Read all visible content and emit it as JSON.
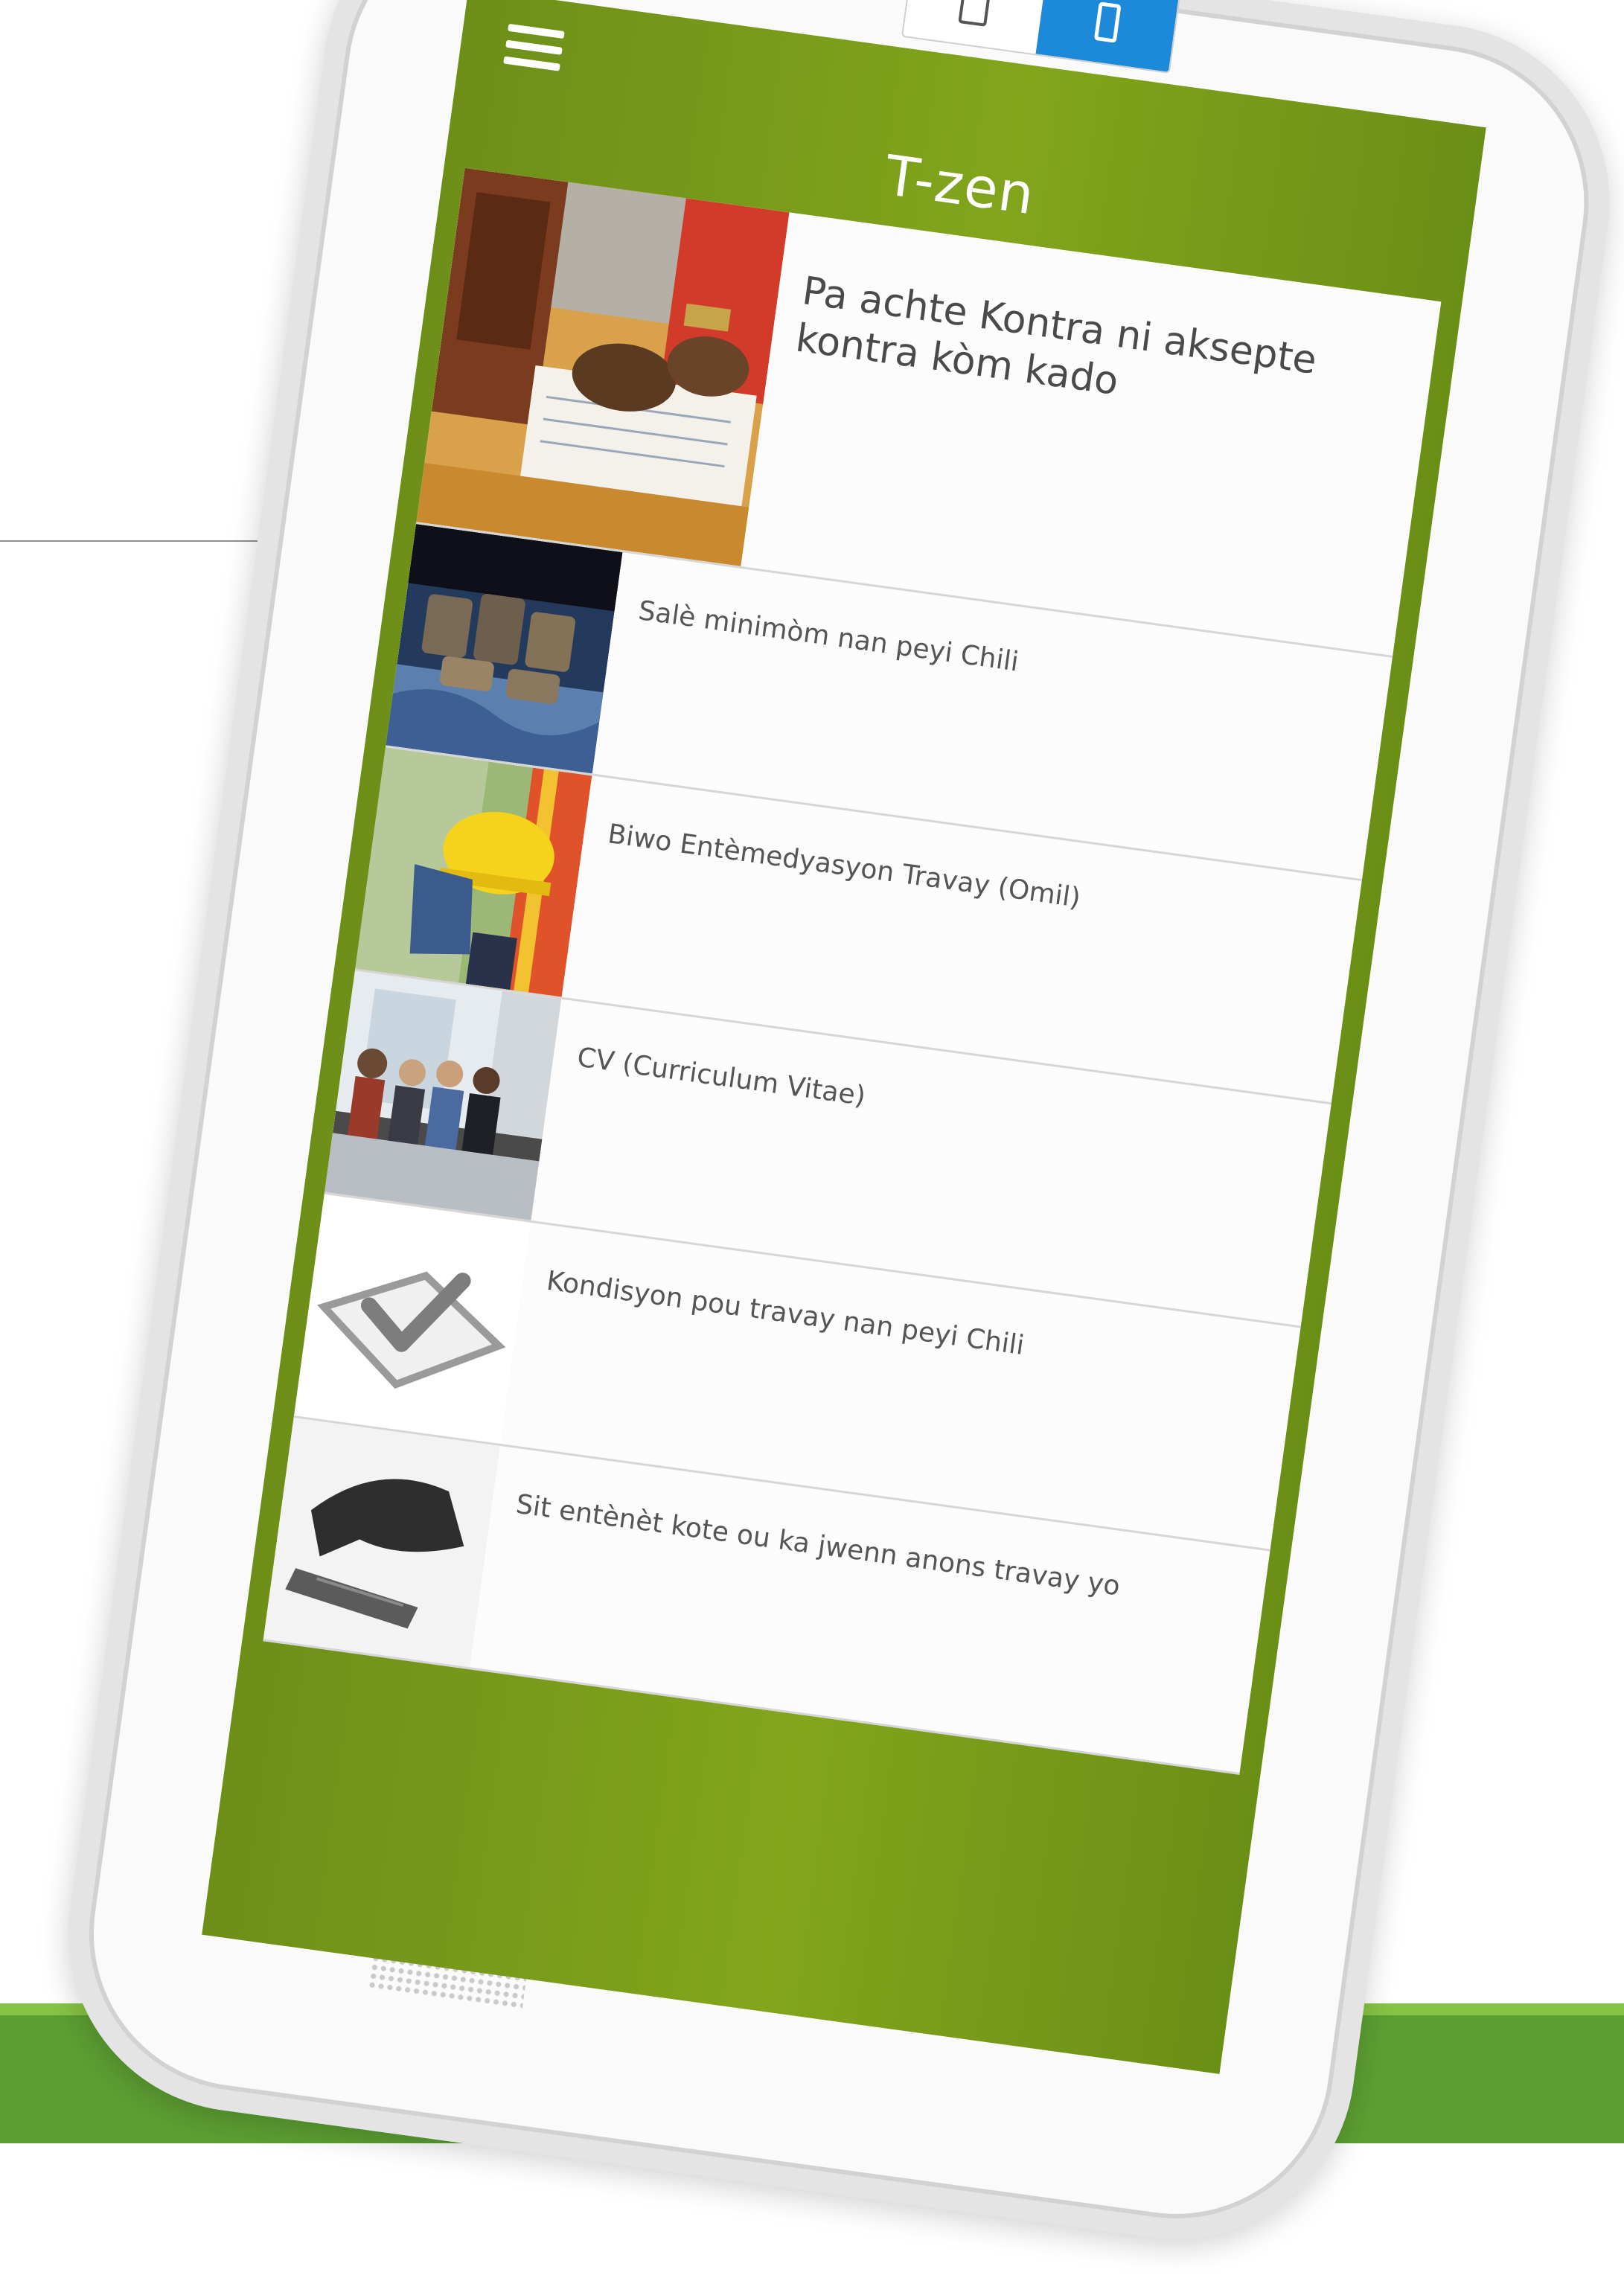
{
  "device_toggle": {
    "tablet_icon": "tablet-icon",
    "phone_icon": "phone-icon",
    "active": "phone"
  },
  "header": {
    "menu_icon": "hamburger-menu-icon",
    "title": "T-zen"
  },
  "articles": [
    {
      "title": "Pa achte Kontra ni aksepte kontra kòm kado",
      "image": "contract-signing-photo"
    },
    {
      "title": "Salè minimòm nan peyi Chili",
      "image": "coins-money-photo"
    },
    {
      "title": "Biwo Entèmedyasyon Travay (Omil)",
      "image": "hardhat-worker-photo"
    },
    {
      "title": "CV (Curriculum Vitae)",
      "image": "job-interview-waiting-photo"
    },
    {
      "title": "Kondisyon pou travay nan peyi Chili",
      "image": "checkmark-box-graphic"
    },
    {
      "title": "Sit entènèt kote ou ka jwenn anons travay yo",
      "image": "hand-typing-photo"
    }
  ],
  "colors": {
    "app_green": "#7a9c1a",
    "bottom_band": "#5c9f32",
    "toggle_active": "#1c8ad8"
  }
}
